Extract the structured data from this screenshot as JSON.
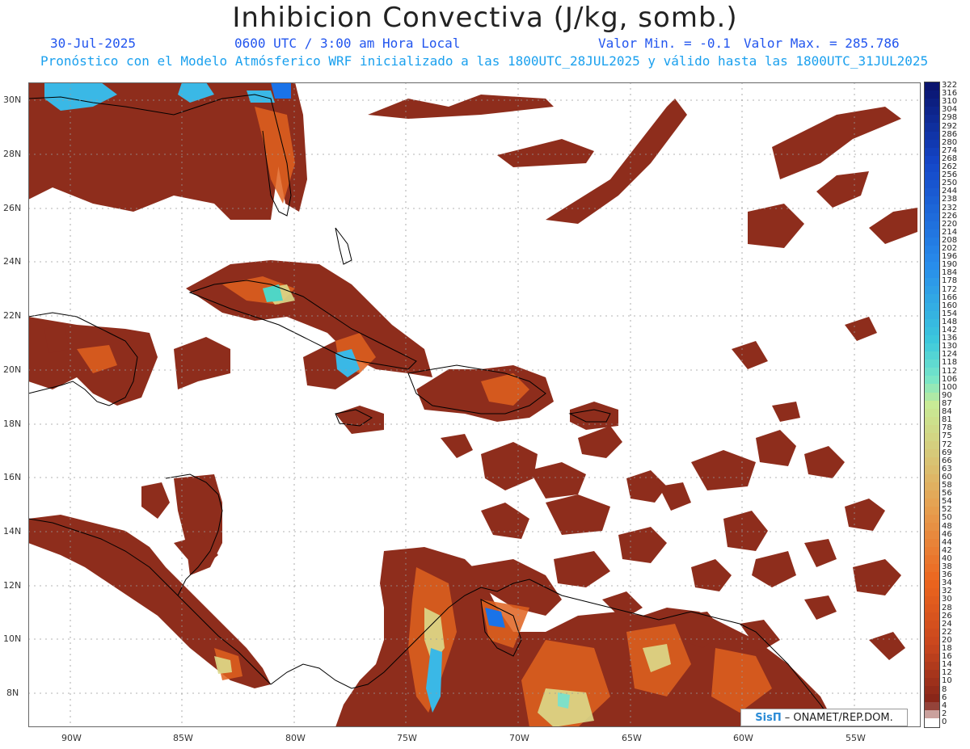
{
  "header": {
    "title": "Inhibicion Convectiva (J/kg, somb.)",
    "date": "30-Jul-2025",
    "time": "0600 UTC / 3:00 am Hora Local",
    "valmin": "Valor Min. = -0.1",
    "valmax": "Valor Max. = 285.786",
    "forecast": "Pronóstico con el Modelo Atmósferico WRF inicializado a las 1800UTC_28JUL2025 y válido hasta las  1800UTC_31JUL2025"
  },
  "axes": {
    "lat_labels": [
      "30N",
      "28N",
      "26N",
      "24N",
      "22N",
      "20N",
      "18N",
      "16N",
      "14N",
      "12N",
      "10N",
      "8N"
    ],
    "lon_labels": [
      "90W",
      "85W",
      "80W",
      "75W",
      "70W",
      "65W",
      "60W",
      "55W"
    ]
  },
  "legend": {
    "labels": [
      "322",
      "316",
      "310",
      "304",
      "298",
      "292",
      "286",
      "280",
      "274",
      "268",
      "262",
      "256",
      "250",
      "244",
      "238",
      "232",
      "226",
      "220",
      "214",
      "208",
      "202",
      "196",
      "190",
      "184",
      "178",
      "172",
      "166",
      "160",
      "154",
      "148",
      "142",
      "136",
      "130",
      "124",
      "118",
      "112",
      "106",
      "100",
      "90",
      "87",
      "84",
      "81",
      "78",
      "75",
      "72",
      "69",
      "66",
      "63",
      "60",
      "58",
      "56",
      "54",
      "52",
      "50",
      "48",
      "46",
      "44",
      "42",
      "40",
      "38",
      "36",
      "34",
      "32",
      "30",
      "28",
      "26",
      "24",
      "22",
      "20",
      "18",
      "16",
      "14",
      "12",
      "10",
      "8",
      "6",
      "4",
      "2",
      "0"
    ]
  },
  "credit": {
    "logo": "SisΠ",
    "text": "– ONAMET/REP.DOM."
  },
  "colors": {
    "cin_low": "#8b2a1a",
    "cin_mid": "#e8622a",
    "cin_high": "#f2c77a",
    "cin_very_high": "#3ad6d6",
    "cin_extreme": "#1a73e8",
    "coast": "#000000"
  }
}
